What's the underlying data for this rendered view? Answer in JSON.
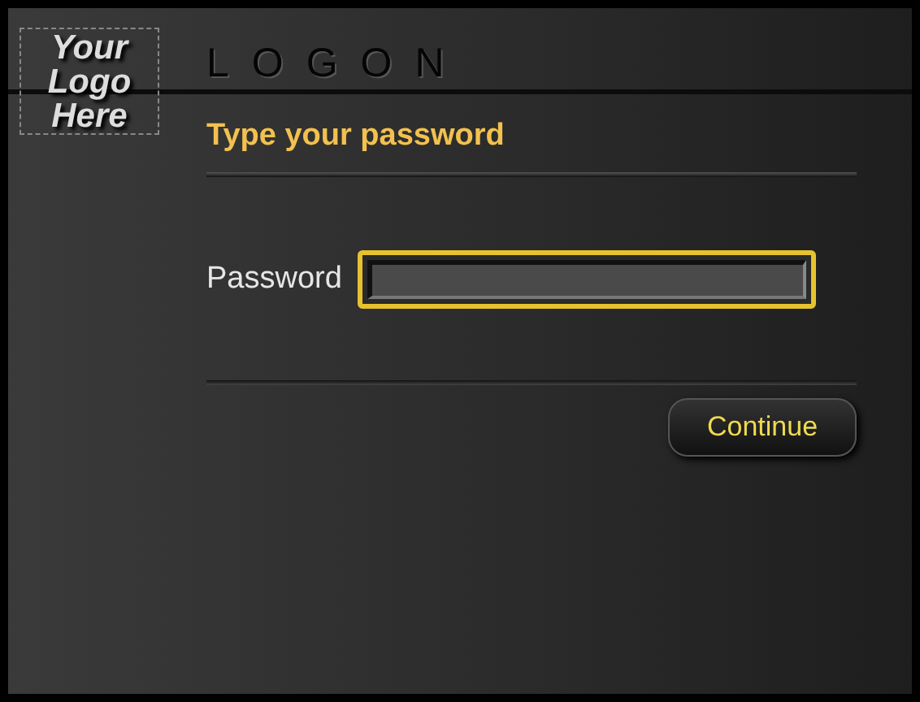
{
  "logo": {
    "lines": [
      "Your",
      "Logo",
      "Here"
    ]
  },
  "header": {
    "title": "LOGON"
  },
  "heading": "Type your password",
  "password_field": {
    "label": "Password",
    "focused": true
  },
  "buttons": [
    {
      "label": "Continue"
    }
  ]
}
